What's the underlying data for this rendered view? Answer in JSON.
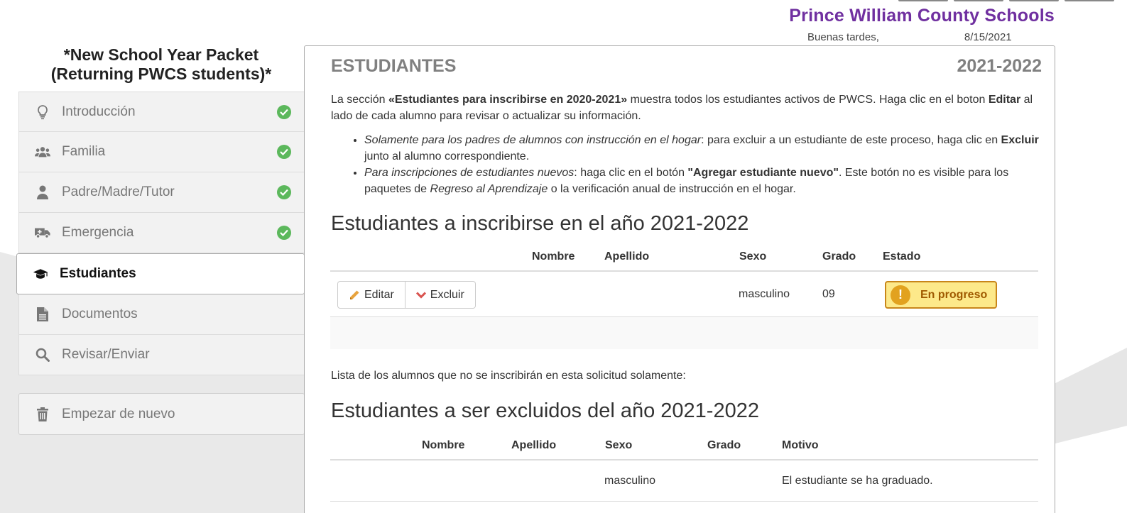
{
  "header": {
    "org_title": "Prince William County Schools",
    "greeting": "Buenas tardes,",
    "date": "8/15/2021"
  },
  "sidebar": {
    "packet_title_line1": "*New School Year Packet",
    "packet_title_line2": "(Returning PWCS students)*",
    "items": [
      {
        "label": "Introducción",
        "icon": "lightbulb-icon",
        "complete": true
      },
      {
        "label": "Familia",
        "icon": "users-icon",
        "complete": true
      },
      {
        "label": "Padre/Madre/Tutor",
        "icon": "user-icon",
        "complete": true
      },
      {
        "label": "Emergencia",
        "icon": "ambulance-icon",
        "complete": true
      },
      {
        "label": "Estudiantes",
        "icon": "graduation-cap-icon",
        "active": true
      },
      {
        "label": "Documentos",
        "icon": "document-icon"
      },
      {
        "label": "Revisar/Enviar",
        "icon": "search-icon"
      }
    ],
    "restart_label": "Empezar de nuevo"
  },
  "main": {
    "section_title": "ESTUDIANTES",
    "school_year": "2021-2022",
    "intro_part1": "La sección ",
    "intro_bold1": "«Estudiantes para inscribirse en 2020-2021»",
    "intro_part2": " muestra todos los estudiantes activos de PWCS. Haga clic en el boton ",
    "intro_bold2": "Editar",
    "intro_part3": " al lado de cada alumno para revisar o actualizar su información.",
    "bullet1_italic": "Solamente para los padres de alumnos con instrucción en el hogar",
    "bullet1_text": ": para excluir a un estudiante de este proceso, haga clic en ",
    "bullet1_bold": "Excluir",
    "bullet1_end": " junto al alumno correspondiente.",
    "bullet2_italic": "Para inscripciones de estudiantes nuevos",
    "bullet2_text": ": haga clic en el botón ",
    "bullet2_bold": "\"Agregar estudiante nuevo\"",
    "bullet2_text2": ". Este botón no es visible para los paquetes de ",
    "bullet2_italic2": "Regreso al Aprendizaje",
    "bullet2_end": " o la verificación anual de instrucción en el hogar.",
    "enroll_heading": "Estudiantes a inscribirse en el año 2021-2022",
    "enroll_columns": [
      "Nombre",
      "Apellido",
      "Sexo",
      "Grado",
      "Estado"
    ],
    "enroll_rows": [
      {
        "nombre": "",
        "apellido": "",
        "sexo": "masculino",
        "grado": "09",
        "estado": "En progreso"
      }
    ],
    "edit_label": "Editar",
    "exclude_label": "Excluir",
    "excluded_note": "Lista de los alumnos que no se inscribirán en esta solicitud solamente:",
    "exclude_heading": "Estudiantes a ser excluidos del año 2021-2022",
    "exclude_columns": [
      "Nombre",
      "Apellido",
      "Sexo",
      "Grado",
      "Motivo"
    ],
    "exclude_rows": [
      {
        "nombre": "",
        "apellido": "",
        "sexo": "masculino",
        "grado": "",
        "motivo": "El estudiante se ha graduado."
      }
    ]
  },
  "colors": {
    "brand": "#7030a0",
    "success": "#5cb85c",
    "warning_bg": "#fde98a",
    "warning_border": "#c8861a",
    "exclude_icon": "#d9534f",
    "edit_icon": "#e8a33d"
  }
}
